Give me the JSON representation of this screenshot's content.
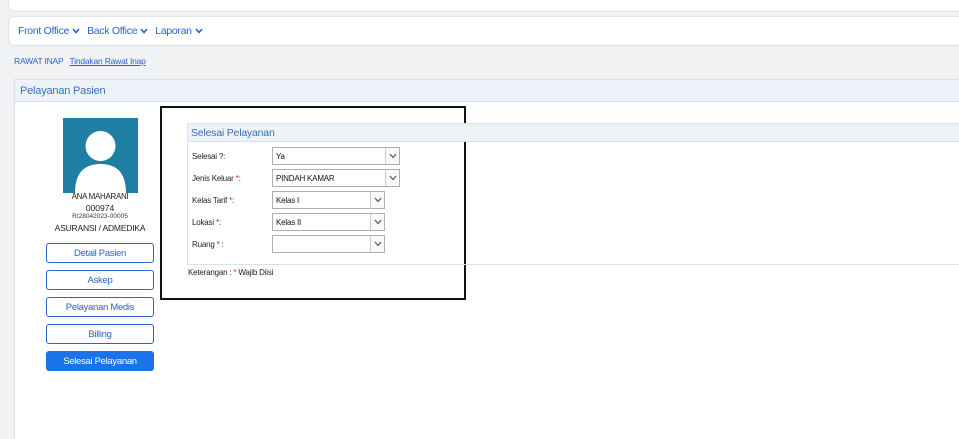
{
  "nav": {
    "items": [
      {
        "label": "Front Office"
      },
      {
        "label": "Back Office"
      },
      {
        "label": "Laporan"
      }
    ]
  },
  "breadcrumb": {
    "section": "RAWAT INAP",
    "link": "Tindakan Rawat Inap"
  },
  "panel": {
    "title": "Pelayanan Pasien"
  },
  "patient": {
    "name": "ANA MAHARANI",
    "id": "000974",
    "reg_no": "RI28042023-00005",
    "insurance": "ASURANSI / ADMEDIKA"
  },
  "sidebar": {
    "buttons": [
      {
        "label": "Detail Pasien"
      },
      {
        "label": "Askep"
      },
      {
        "label": "Pelayanan Medis"
      },
      {
        "label": "Billing"
      },
      {
        "label": "Selesai Pelayanan"
      }
    ],
    "active_index": 4
  },
  "form": {
    "title": "Selesai Pelayanan",
    "fields": [
      {
        "label": "Selesai ?:",
        "required_mark": "",
        "value": ""
      },
      {
        "label": "Jenis Keluar ",
        "required_mark": "*",
        "suffix": ":",
        "value": "PINDAH KAMAR"
      },
      {
        "label": "Kelas Tarif ",
        "required_mark": "*",
        "suffix": ":",
        "value": "Kelas I"
      },
      {
        "label": "Lokasi ",
        "required_mark": "*",
        "suffix": ":",
        "value": "Kelas II"
      },
      {
        "label": "Ruang ",
        "required_mark": "*",
        "suffix": " :",
        "value": ""
      }
    ],
    "selesai_value": "Ya",
    "note_prefix": "Keterangan : ",
    "note_mark": "*",
    "note_suffix": " Wajib Diisi"
  },
  "colors": {
    "accent": "#2b63c8",
    "active_button": "#1a73e8",
    "avatar_bg": "#1f7ea3",
    "required": "#dd1111"
  }
}
